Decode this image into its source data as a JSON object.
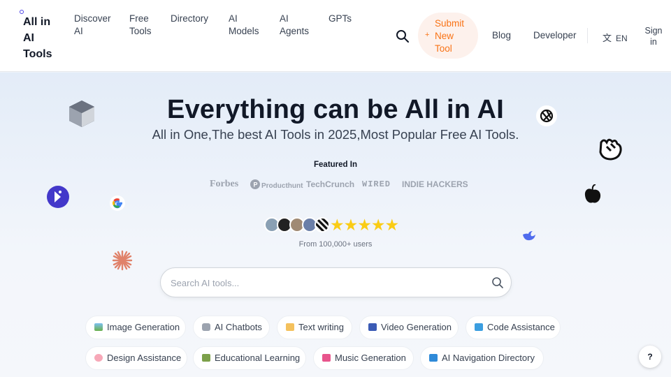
{
  "logo": {
    "text": "All in AI Tools"
  },
  "nav": {
    "discover": "Discover AI",
    "free_tools": "Free Tools",
    "directory": "Directory",
    "ai_models": "AI Models",
    "ai_agents": "AI Agents",
    "gpts": "GPTs",
    "submit": "Submit New Tool",
    "blog": "Blog",
    "developer": "Developer",
    "lang": "EN",
    "signin": "Sign in"
  },
  "hero": {
    "title": "Everything can be All in AI",
    "subtitle": "All in One,The best AI Tools in 2025,Most Popular Free AI Tools.",
    "featured_label": "Featured In",
    "press": [
      "Forbes",
      "Producthunt",
      "TechCrunch",
      "WIRED",
      "INDIE HACKERS"
    ],
    "stars": "★★★★★",
    "users": "From 100,000+ users"
  },
  "search": {
    "placeholder": "Search AI tools..."
  },
  "categories": [
    "Image Generation",
    "AI Chatbots",
    "Text writing",
    "Video Generation",
    "Code Assistance",
    "Design Assistance",
    "Educational Learning",
    "Music Generation",
    "AI Navigation Directory"
  ],
  "help": "?",
  "colors": {
    "accent": "#f97316",
    "star": "#facc15",
    "logo_ring": "#4f46e5"
  }
}
